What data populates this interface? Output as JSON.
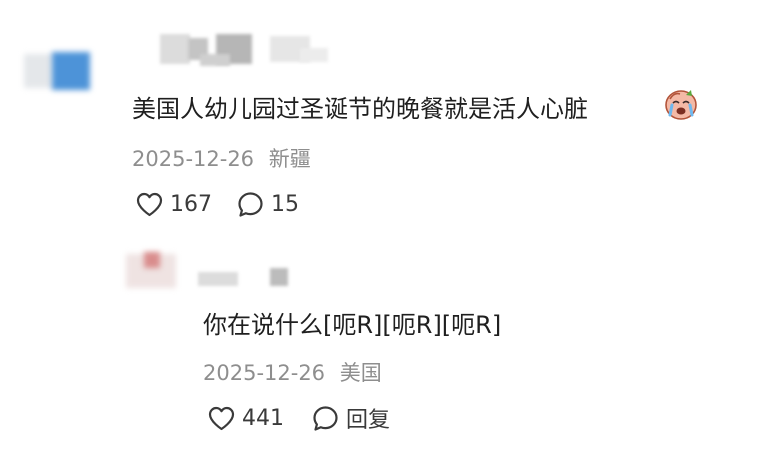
{
  "comments": [
    {
      "text": "美国人幼儿园过圣诞节的晚餐就是活人心脏",
      "emoji": "crying-face-emoji",
      "date": "2025-12-26",
      "location": "新疆",
      "likes": "167",
      "replies": "15"
    }
  ],
  "reply": {
    "text": "你在说什么[呃R][呃R][呃R]",
    "date": "2025-12-26",
    "location": "美国",
    "likes": "441",
    "reply_label": "回复"
  }
}
